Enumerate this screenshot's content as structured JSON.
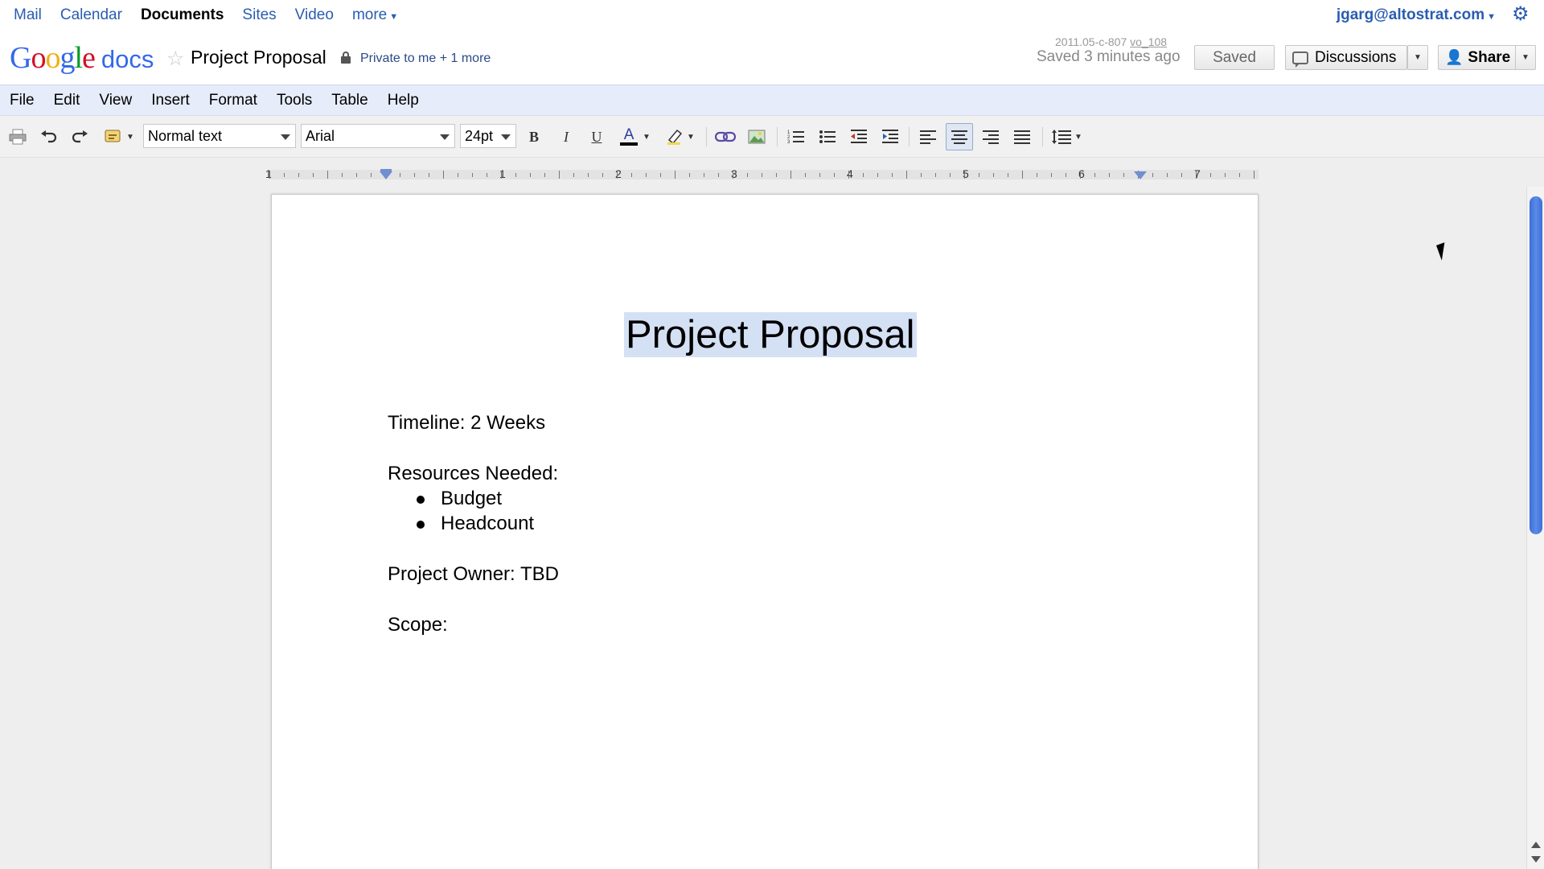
{
  "topnav": {
    "items": [
      "Mail",
      "Calendar",
      "Documents",
      "Sites",
      "Video",
      "more"
    ],
    "active": "Documents",
    "account": "jgarg@altostrat.com"
  },
  "titlebar": {
    "logo_google": "Google",
    "logo_docs": "docs",
    "doc_title": "Project Proposal",
    "sharing": "Private to me + 1 more",
    "version_prefix": "2011.05-c-807",
    "version_suffix": "vo_108",
    "saved_status": "Saved 3 minutes ago",
    "saved_button": "Saved",
    "discussions_button": "Discussions",
    "share_button": "Share"
  },
  "menu": [
    "File",
    "Edit",
    "View",
    "Insert",
    "Format",
    "Tools",
    "Table",
    "Help"
  ],
  "toolbar": {
    "style_select": "Normal text",
    "font_select": "Arial",
    "size_select": "24pt",
    "bold": "B",
    "italic": "I",
    "underline": "U",
    "text_color": "A"
  },
  "ruler": {
    "labels": [
      "1",
      "1",
      "2",
      "3",
      "4",
      "5",
      "6",
      "7"
    ]
  },
  "document": {
    "heading": "Project Proposal",
    "timeline": "Timeline: 2 Weeks",
    "resources": "Resources Needed:",
    "bullets": [
      "Budget",
      "Headcount"
    ],
    "owner": "Project Owner: TBD",
    "scope": "Scope:"
  },
  "colors": {
    "link_blue": "#2a5db0",
    "menubar_bg": "#e6ecfa",
    "selection": "#d4e0f4",
    "scroll_thumb": "#3d6fd6"
  }
}
